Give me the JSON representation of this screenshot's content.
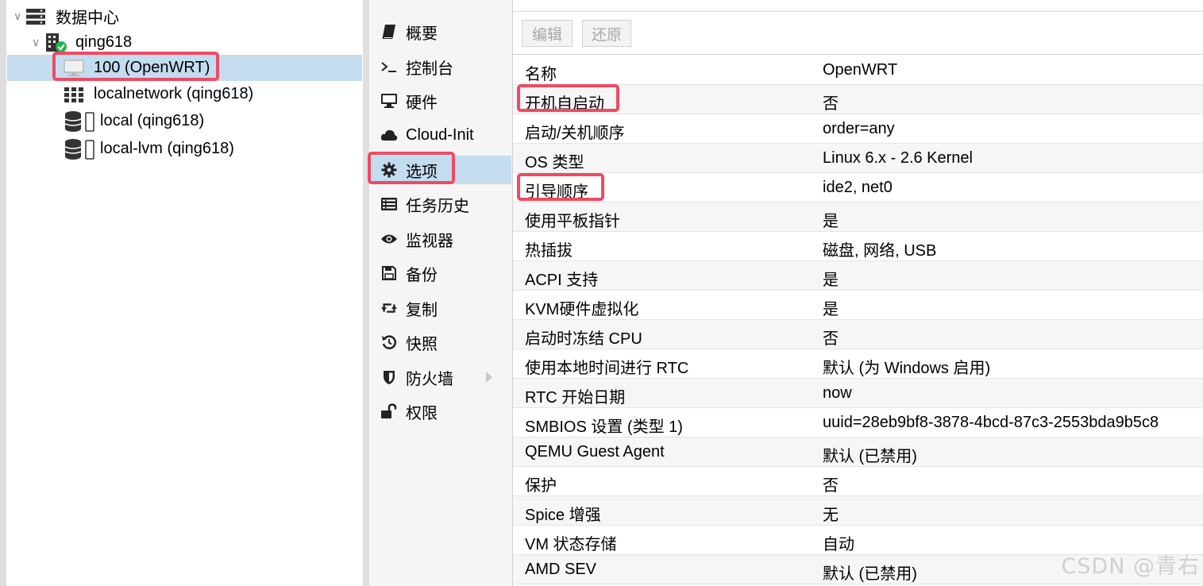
{
  "tree": {
    "datacenter": "数据中心",
    "node": "qing618",
    "vm": "100 (OpenWRT)",
    "network": "localnetwork (qing618)",
    "storage_local": "local (qing618)",
    "storage_lvm": "local-lvm (qing618)"
  },
  "nav": {
    "items": [
      {
        "label": "概要",
        "icon": "book-icon"
      },
      {
        "label": "控制台",
        "icon": "terminal-icon"
      },
      {
        "label": "硬件",
        "icon": "monitor-icon"
      },
      {
        "label": "Cloud-Init",
        "icon": "cloud-icon"
      },
      {
        "label": "选项",
        "icon": "gear-icon",
        "selected": true
      },
      {
        "label": "任务历史",
        "icon": "list-icon"
      },
      {
        "label": "监视器",
        "icon": "eye-icon"
      },
      {
        "label": "备份",
        "icon": "floppy-icon"
      },
      {
        "label": "复制",
        "icon": "retweet-icon"
      },
      {
        "label": "快照",
        "icon": "history-icon"
      },
      {
        "label": "防火墙",
        "icon": "shield-icon",
        "has_submenu": true
      },
      {
        "label": "权限",
        "icon": "unlock-icon"
      }
    ]
  },
  "toolbar": {
    "edit_label": "编辑",
    "revert_label": "还原"
  },
  "options": [
    {
      "key": "名称",
      "value": "OpenWRT"
    },
    {
      "key": "开机自启动",
      "value": "否"
    },
    {
      "key": "启动/关机顺序",
      "value": "order=any"
    },
    {
      "key": "OS 类型",
      "value": "Linux 6.x - 2.6 Kernel"
    },
    {
      "key": "引导顺序",
      "value": "ide2, net0"
    },
    {
      "key": "使用平板指针",
      "value": "是"
    },
    {
      "key": "热插拔",
      "value": "磁盘, 网络, USB"
    },
    {
      "key": "ACPI 支持",
      "value": "是"
    },
    {
      "key": "KVM硬件虚拟化",
      "value": "是"
    },
    {
      "key": "启动时冻结 CPU",
      "value": "否"
    },
    {
      "key": "使用本地时间进行 RTC",
      "value": "默认 (为 Windows 启用)"
    },
    {
      "key": "RTC 开始日期",
      "value": "now"
    },
    {
      "key": "SMBIOS 设置 (类型 1)",
      "value": "uuid=28eb9bf8-3878-4bcd-87c3-2553bda9b5c8"
    },
    {
      "key": "QEMU Guest Agent",
      "value": "默认 (已禁用)"
    },
    {
      "key": "保护",
      "value": "否"
    },
    {
      "key": "Spice 增强",
      "value": "无"
    },
    {
      "key": "VM 状态存储",
      "value": "自动"
    },
    {
      "key": "AMD SEV",
      "value": "默认 (已禁用)"
    }
  ],
  "watermark": "CSDN @青右",
  "colors": {
    "selection": "#c4dcf0",
    "highlight": "#ef4a63",
    "status_ok": "#22b14c"
  }
}
